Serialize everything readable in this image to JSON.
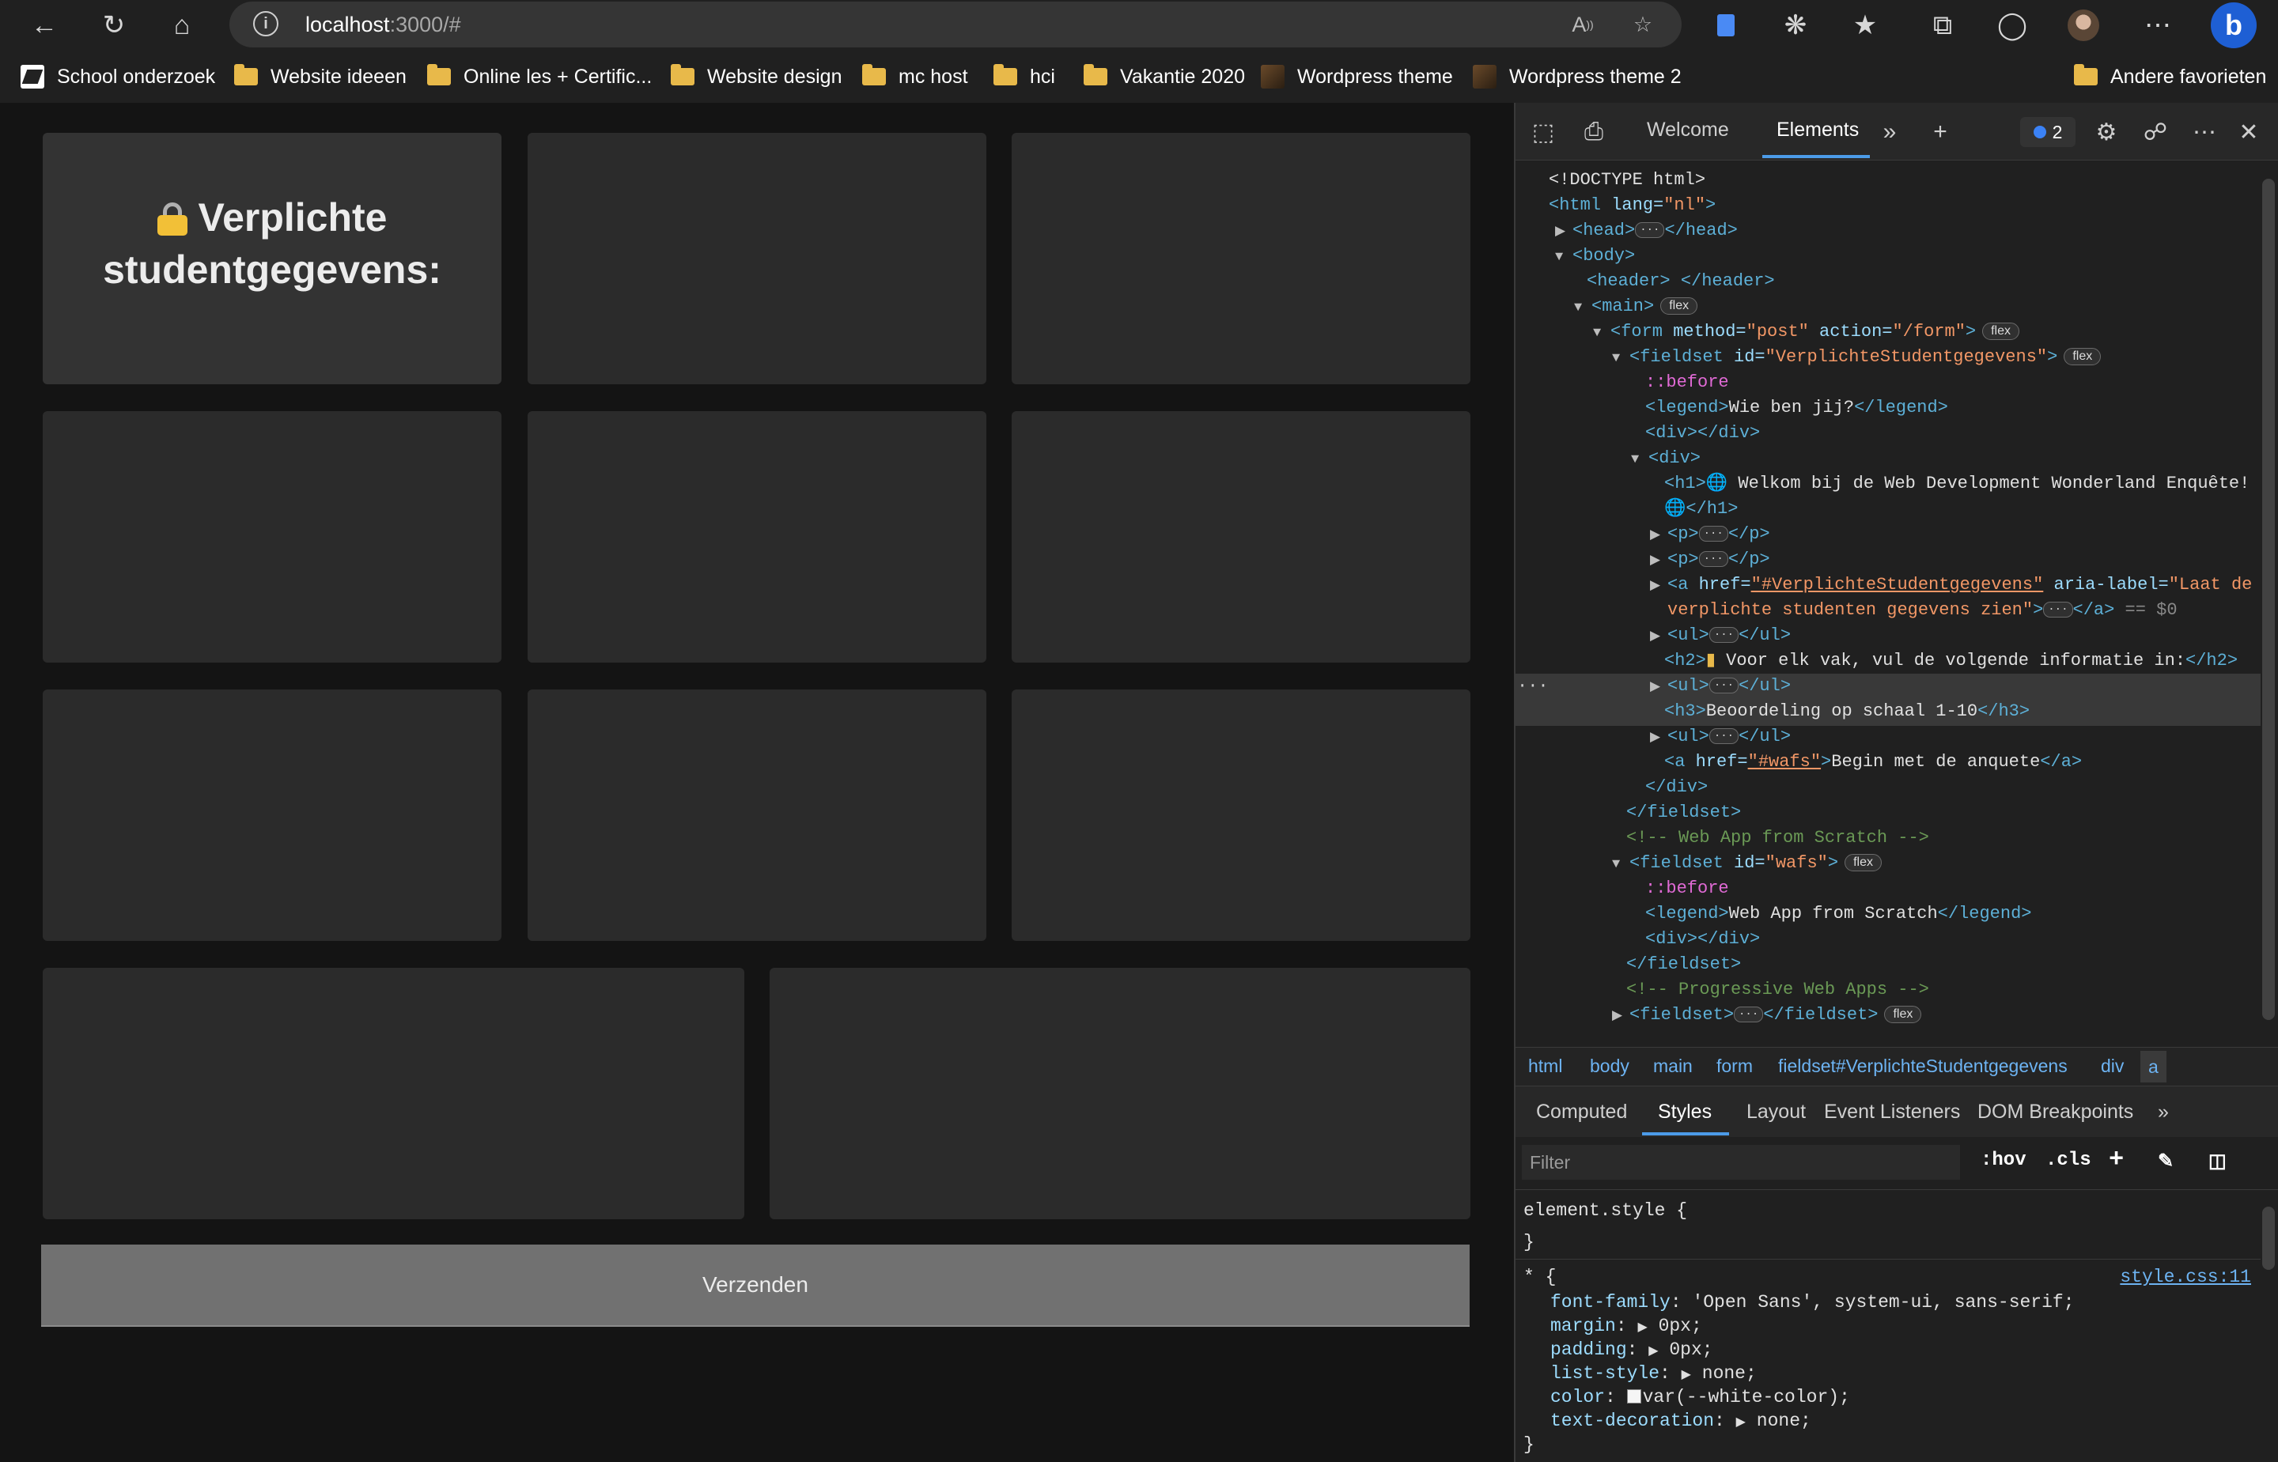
{
  "browser": {
    "address_host": "localhost",
    "address_path": ":3000/#",
    "bookmarks": [
      {
        "label": "School onderzoek",
        "icon": "school-favicon"
      },
      {
        "label": "Website ideeen",
        "icon": "folder-icon"
      },
      {
        "label": "Online les + Certific...",
        "icon": "folder-icon"
      },
      {
        "label": "Website design",
        "icon": "folder-icon"
      },
      {
        "label": "mc host",
        "icon": "folder-icon"
      },
      {
        "label": "hci",
        "icon": "folder-icon"
      },
      {
        "label": "Vakantie 2020",
        "icon": "folder-icon"
      },
      {
        "label": "Wordpress theme",
        "icon": "wordpress-favicon"
      },
      {
        "label": "Wordpress theme 2",
        "icon": "wordpress-favicon"
      }
    ],
    "other_favorites": "Andere favorieten"
  },
  "page": {
    "card_title": "Verplichte studentgegevens:",
    "submit_label": "Verzenden",
    "card_color": "#2b2b2b",
    "background_color": "#141414"
  },
  "devtools": {
    "tabs": {
      "welcome": "Welcome",
      "elements": "Elements"
    },
    "issues_count": "2",
    "tree": {
      "doctype": "<!DOCTYPE html>",
      "html_open": "<html ",
      "html_attr": "lang=",
      "html_val": "\"nl\"",
      "html_close": ">",
      "head": "<head>",
      "head_end": "</head>",
      "body": "<body>",
      "header": "<header> </header>",
      "main": "<main>",
      "flex": "flex",
      "form_open": "<form ",
      "form_method": "method=",
      "form_method_val": "\"post\"",
      "form_action": " action=",
      "form_action_val": "\"/form\"",
      "gt": ">",
      "fieldset_open": "<fieldset ",
      "id_attr": "id=",
      "fieldset_id_val": "\"VerplichteStudentgegevens\"",
      "before": "::before",
      "legend_open": "<legend>",
      "legend_text": "Wie ben jij?",
      "legend_close": "</legend>",
      "div_empty": "<div></div>",
      "div_open": "<div>",
      "h1_open": "<h1>",
      "h1_text": " Welkom bij de Web Development Wonderland Enquête!",
      "h1_close": "</h1>",
      "p_open": "<p>",
      "p_close": "</p>",
      "a_open": "<a ",
      "href_attr": "href=",
      "href_val": "\"#VerplichteStudentgegevens\"",
      "aria_attr": " aria-label=",
      "aria_val_1": "\"Laat de",
      "aria_val_2": "verplichte studenten gegevens zien\"",
      "a_close": "</a>",
      "eq": "== $0",
      "ul_open": "<ul>",
      "ul_close": "</ul>",
      "h2_open": "<h2>",
      "h2_text": " Voor elk vak, vul de volgende informatie in:",
      "h2_close": "</h2>",
      "h3_open": "<h3>",
      "h3_text": "Beoordeling op schaal 1-10",
      "h3_close": "</h3>",
      "wafs_href_val": "\"#wafs\"",
      "wafs_link_text": "Begin met de anquete",
      "div_close": "</div>",
      "fieldset_close": "</fieldset>",
      "comment_wafs": "<!-- Web App from Scratch -->",
      "fieldset_wafs_val": "\"wafs\"",
      "legend_wafs": "Web App from Scratch",
      "comment_pwa": "<!-- Progressive Web Apps -->",
      "fieldset": "<fieldset>"
    },
    "breadcrumbs": [
      "html",
      "body",
      "main",
      "form",
      "fieldset#VerplichteStudentgegevens",
      "div",
      "a"
    ],
    "style_tabs": [
      "Computed",
      "Styles",
      "Layout",
      "Event Listeners",
      "DOM Breakpoints"
    ],
    "filter_placeholder": "Filter",
    "hov": ":hov",
    "cls": ".cls",
    "styles": {
      "element_style": "element.style {",
      "close_brace": "}",
      "universal": "* {",
      "source": "style.css:11",
      "props": [
        {
          "name": "font-family",
          "value": "'Open Sans', system-ui, sans-serif;"
        },
        {
          "name": "margin",
          "value": "0px;",
          "arrow": true
        },
        {
          "name": "padding",
          "value": "0px;",
          "arrow": true
        },
        {
          "name": "list-style",
          "value": "none;",
          "arrow": true
        },
        {
          "name": "color",
          "value": "var(--white-color);",
          "swatch": true
        },
        {
          "name": "text-decoration",
          "value": "none;",
          "arrow": true
        }
      ]
    }
  }
}
